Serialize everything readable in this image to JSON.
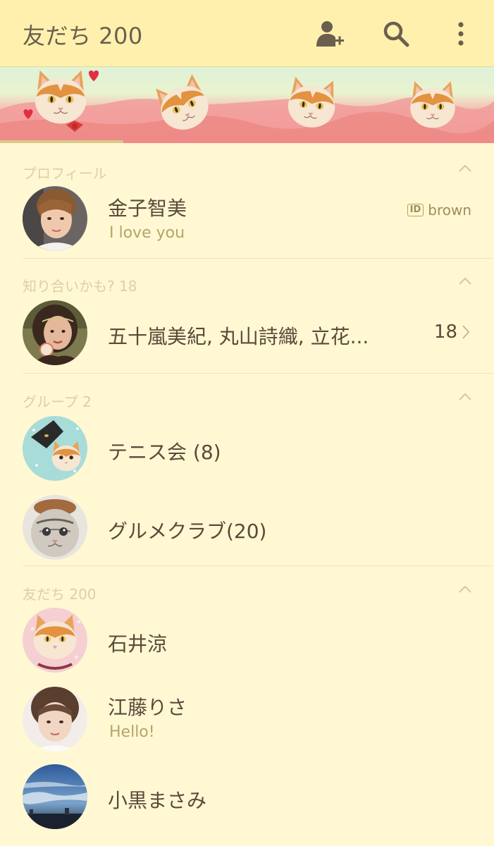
{
  "header": {
    "title": "友だち 200",
    "icons": [
      "add-friend-icon",
      "search-icon",
      "more-vert-icon"
    ],
    "background": "#fff1ad"
  },
  "banner": {
    "progress": 0.25,
    "icons": [
      "cat-face",
      "heart",
      "bow"
    ]
  },
  "sections": {
    "profile": {
      "label": "プロフィール",
      "name": "金子智美",
      "status": "I love you",
      "id_badge": "ID",
      "id_value": "brown"
    },
    "suggested": {
      "label": "知り合いかも? 18",
      "names": "五十嵐美紀, 丸山詩織, 立花...",
      "count": "18"
    },
    "groups": {
      "label": "グループ  2",
      "items": [
        {
          "name": "テニス会 (8)"
        },
        {
          "name": "グルメクラブ(20)"
        }
      ]
    },
    "friends": {
      "label": "友だち 200",
      "items": [
        {
          "name": "石井涼",
          "status": ""
        },
        {
          "name": "江藤りさ",
          "status": "Hello!"
        },
        {
          "name": "小黒まさみ",
          "status": ""
        }
      ]
    }
  },
  "colors": {
    "background": "#fff8d3",
    "section_label": "#dcd0a6",
    "status_text": "#b5a46a",
    "name_text": "#5a4a3a"
  }
}
